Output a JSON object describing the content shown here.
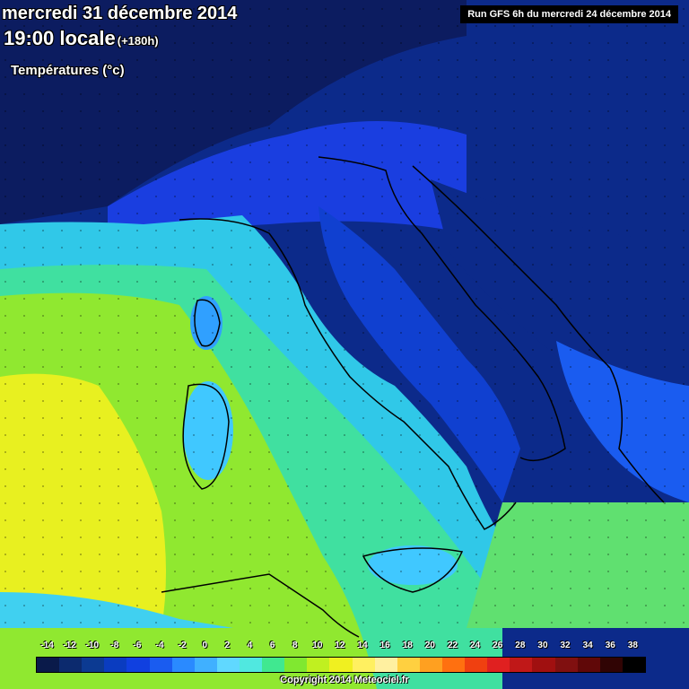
{
  "header": {
    "date": "mercredi 31 décembre 2014",
    "time": "19:00 locale",
    "lead": "(+180h)",
    "variable": "Températures (°c)",
    "run": "Run GFS 6h du mercredi 24 décembre 2014"
  },
  "legend": {
    "labels": [
      "-14",
      "-12",
      "-10",
      "-8",
      "-6",
      "-4",
      "-2",
      "0",
      "2",
      "4",
      "6",
      "8",
      "10",
      "12",
      "14",
      "16",
      "18",
      "20",
      "22",
      "24",
      "26",
      "28",
      "30",
      "32",
      "34",
      "36",
      "38"
    ],
    "colors": [
      "#0a1a4a",
      "#0c2a6e",
      "#0c3a92",
      "#0a3cc0",
      "#1040e0",
      "#1a5cf0",
      "#2a8aff",
      "#40b0ff",
      "#60d8ff",
      "#50e8e0",
      "#40e890",
      "#80e830",
      "#c0f020",
      "#f0f020",
      "#fff060",
      "#fff0a0",
      "#ffd040",
      "#ffa020",
      "#ff7010",
      "#f04010",
      "#e02020",
      "#c01818",
      "#a01010",
      "#801010",
      "#600808",
      "#300404",
      "#000000"
    ]
  },
  "copyright": "Copyright 2014 Meteociel.fr",
  "map": {
    "land": "#1a4ad0",
    "sea_warm": "#a8e030"
  }
}
